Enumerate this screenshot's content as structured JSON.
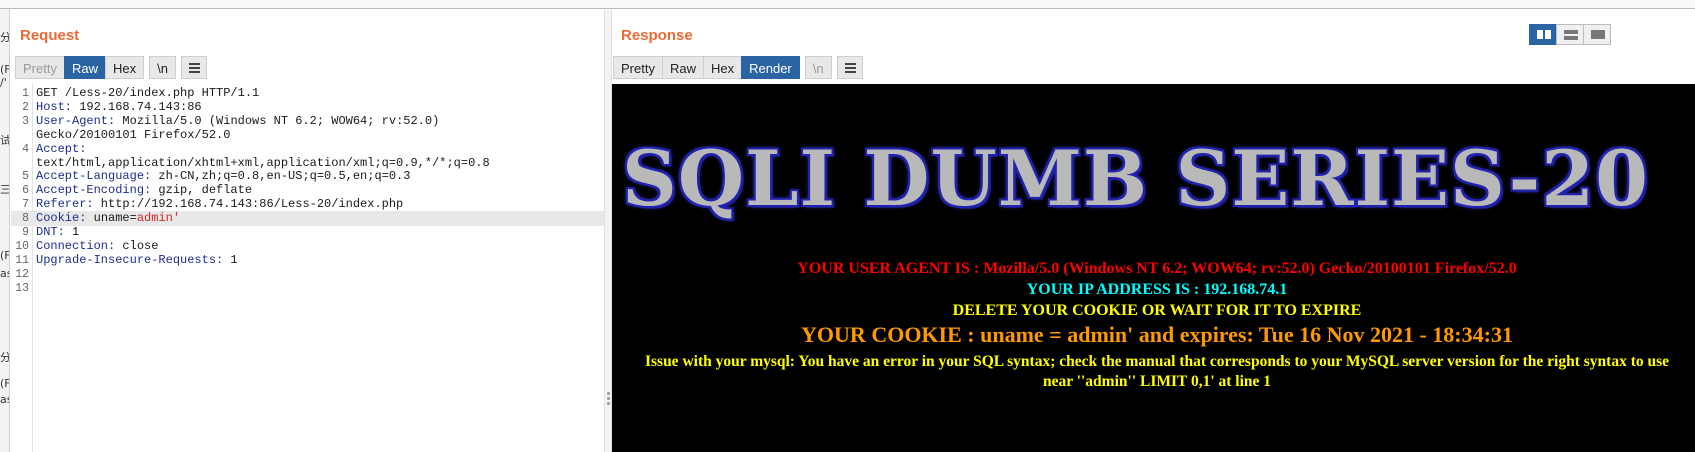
{
  "request": {
    "title": "Request",
    "tabs": [
      "Pretty",
      "Raw",
      "Hex",
      "\\n"
    ],
    "active_tab": "Raw",
    "lines": [
      {
        "n": "1",
        "h": "",
        "v": "GET /Less-20/index.php HTTP/1.1"
      },
      {
        "n": "2",
        "h": "Host:",
        "v": " 192.168.74.143:86"
      },
      {
        "n": "3",
        "h": "User-Agent:",
        "v": " Mozilla/5.0 (Windows NT 6.2; WOW64; rv:52.0)"
      },
      {
        "n": "",
        "h": "",
        "v": "Gecko/20100101 Firefox/52.0"
      },
      {
        "n": "4",
        "h": "Accept:",
        "v": ""
      },
      {
        "n": "",
        "h": "",
        "v": "text/html,application/xhtml+xml,application/xml;q=0.9,*/*;q=0.8"
      },
      {
        "n": "5",
        "h": "Accept-Language:",
        "v": " zh-CN,zh;q=0.8,en-US;q=0.5,en;q=0.3"
      },
      {
        "n": "6",
        "h": "Accept-Encoding:",
        "v": " gzip, deflate"
      },
      {
        "n": "7",
        "h": "Referer:",
        "v": " http://192.168.74.143:86/Less-20/index.php"
      },
      {
        "n": "8",
        "h": "Cookie:",
        "v": " uname=",
        "c": "admin'"
      },
      {
        "n": "9",
        "h": "DNT:",
        "v": " 1"
      },
      {
        "n": "10",
        "h": "Connection:",
        "v": " close"
      },
      {
        "n": "11",
        "h": "Upgrade-Insecure-Requests:",
        "v": " 1"
      },
      {
        "n": "12",
        "h": "",
        "v": ""
      },
      {
        "n": "13",
        "h": "",
        "v": ""
      }
    ]
  },
  "response": {
    "title": "Response",
    "tabs": [
      "Pretty",
      "Raw",
      "Hex",
      "Render",
      "\\n"
    ],
    "active_tab": "Render",
    "render": {
      "banner": "SQLI DUMB SERIES-20",
      "user_agent": "YOUR USER AGENT IS : Mozilla/5.0 (Windows NT 6.2; WOW64; rv:52.0) Gecko/20100101 Firefox/52.0",
      "ip": "YOUR IP ADDRESS IS : 192.168.74.1",
      "delete_cookie": "DELETE YOUR COOKIE OR WAIT FOR IT TO EXPIRE",
      "cookie": "YOUR COOKIE : uname = admin' and expires: Tue 16 Nov 2021 - 18:34:31",
      "error": "Issue with your mysql: You have an error in your SQL syntax; check the manual that corresponds to your MySQL server version for the right syntax to use near ''admin'' LIMIT 0,1' at line 1"
    }
  },
  "left_strip": [
    "分",
    "(F",
    "/'",
    "试",
    "三",
    "(F",
    "as",
    "分",
    "(F",
    "as"
  ],
  "icons": {
    "menu": "hamburger-menu-icon",
    "layout_side_by_side": "columns-layout-icon",
    "layout_stacked": "rows-layout-icon",
    "layout_single": "single-pane-icon"
  },
  "colors": {
    "title": "#ec6b35",
    "active_tab": "#2a64a2",
    "header_name": "#1d2e8f",
    "cookie_value": "#c42b2b"
  }
}
